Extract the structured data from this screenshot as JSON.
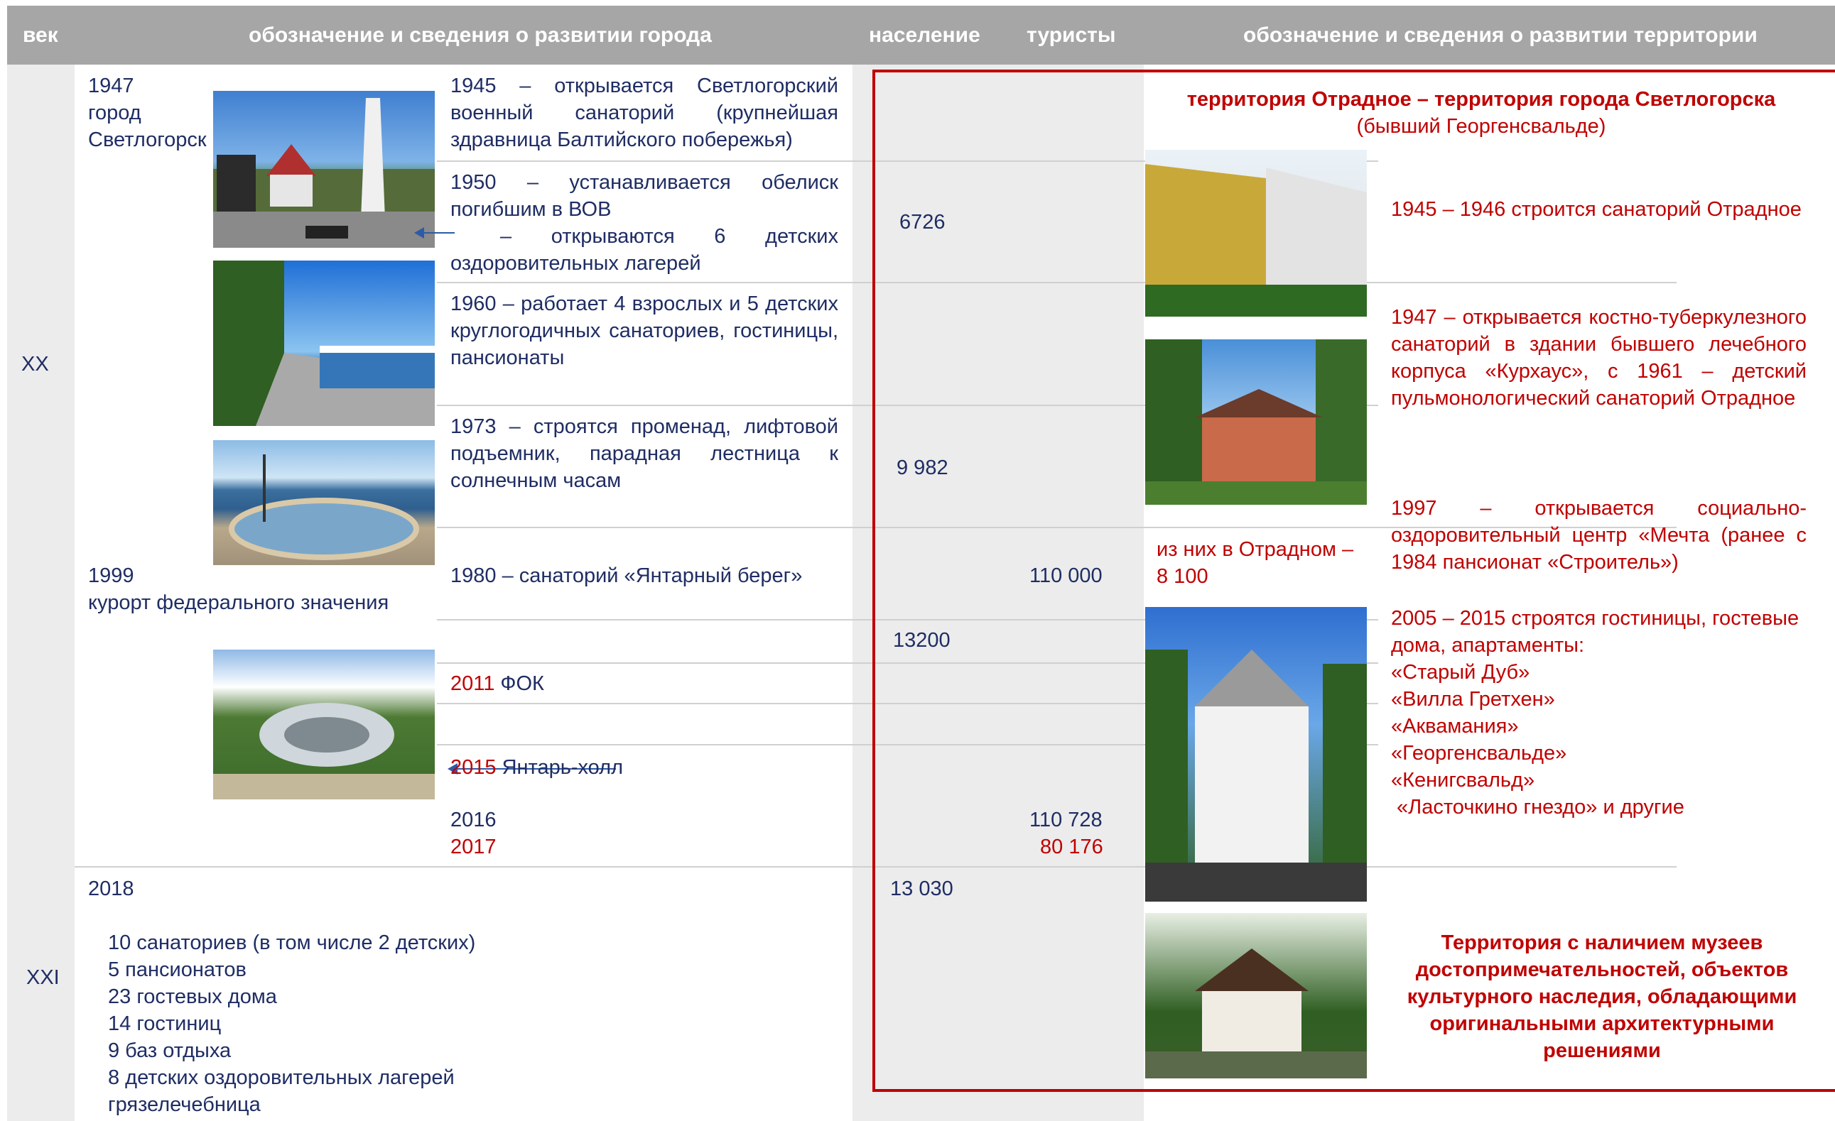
{
  "header": {
    "century": "век",
    "city_info": "обозначение и сведения о развитии города",
    "population": "население",
    "tourists": "туристы",
    "territory_info": "обозначение и сведения о развитии территории"
  },
  "centuries": {
    "xx": "XX",
    "xxi": "XXI"
  },
  "city": {
    "year_1947": "1947",
    "name_1947_line1": "город",
    "name_1947_line2": "Светлогорск",
    "year_1999": "1999",
    "status_1999": "курорт федерального значения",
    "year_2018": "2018",
    "stats_2018": [
      "10 санаториев (в том числе 2 детских)",
      "5 пансионатов",
      "23 гостевых дома",
      "14 гостиниц",
      "9 баз отдыха",
      "8 детских оздоровительных лагерей",
      "грязелечебница"
    ]
  },
  "events": {
    "e1945": "1945 – открывается Светлогорский военный санаторий (крупнейшая здравница Балтийского побережья)",
    "e1950": "1950 – устанавливается обелиск погибшим в ВОВ",
    "e1950b": "– открываются 6 детских оздоровительных лагерей",
    "e1960": "1960 – работает 4 взрослых и 5 детских круглогодичных санаториев, гостиницы, пансионаты",
    "e1973": "1973 – строятся променад, лифтовой подъемник, парадная лестница к солнечным часам",
    "e1980": "1980 – санаторий «Янтарный берег»",
    "e2011_year": "2011",
    "e2011_text": " ФОК",
    "e2015_year": "2015",
    "e2015_text": " Янтарь-холл",
    "y2016": "2016",
    "y2017": "2017"
  },
  "population": {
    "p1": "6726",
    "p2": "9 982",
    "p3": "13200",
    "p4": "13 030"
  },
  "tourists": {
    "t1": "110 000",
    "t2016": "110 728",
    "t2017": "80 176"
  },
  "territory": {
    "title": "территория Отрадное – территория города Светлогорска",
    "subtitle": "(бывший Георгенсвальде)",
    "ev1": "1945 – 1946  строится санаторий Отрадное",
    "ev2": "1947 – открывается костно-туберкулезного санаторий в здании бывшего лечебного корпуса «Курхаус», с 1961 – детский пульмонологический санаторий Отрадное",
    "ev3": "1997 – открывается социально-оздоровительный центр «Мечта (ранее с 1984 пансионат «Строитель»)",
    "otradnoe_pop_line1": "из них в Отрадном –",
    "otradnoe_pop_line2": "8 100",
    "ev4_intro": "2005 – 2015 строятся гостиницы, гостевые дома, апартаменты:",
    "hotels": [
      "«Старый Дуб»",
      "«Вилла Гретхен»",
      "«Аквамания»",
      "«Георгенсвальде»",
      "«Кенигсвальд»",
      " «Ласточкино гнездо» и другие"
    ],
    "summary": "Территория с наличием музеев достопримечательностей, объектов культурного наследия, обладающими оригинальными архитектурными решениями"
  },
  "colors": {
    "header_bg": "#a6a6a6",
    "text_blue": "#1f2d64",
    "accent_red": "#c00000",
    "gray_col": "#ececec",
    "arrow": "#2e5aa8"
  }
}
